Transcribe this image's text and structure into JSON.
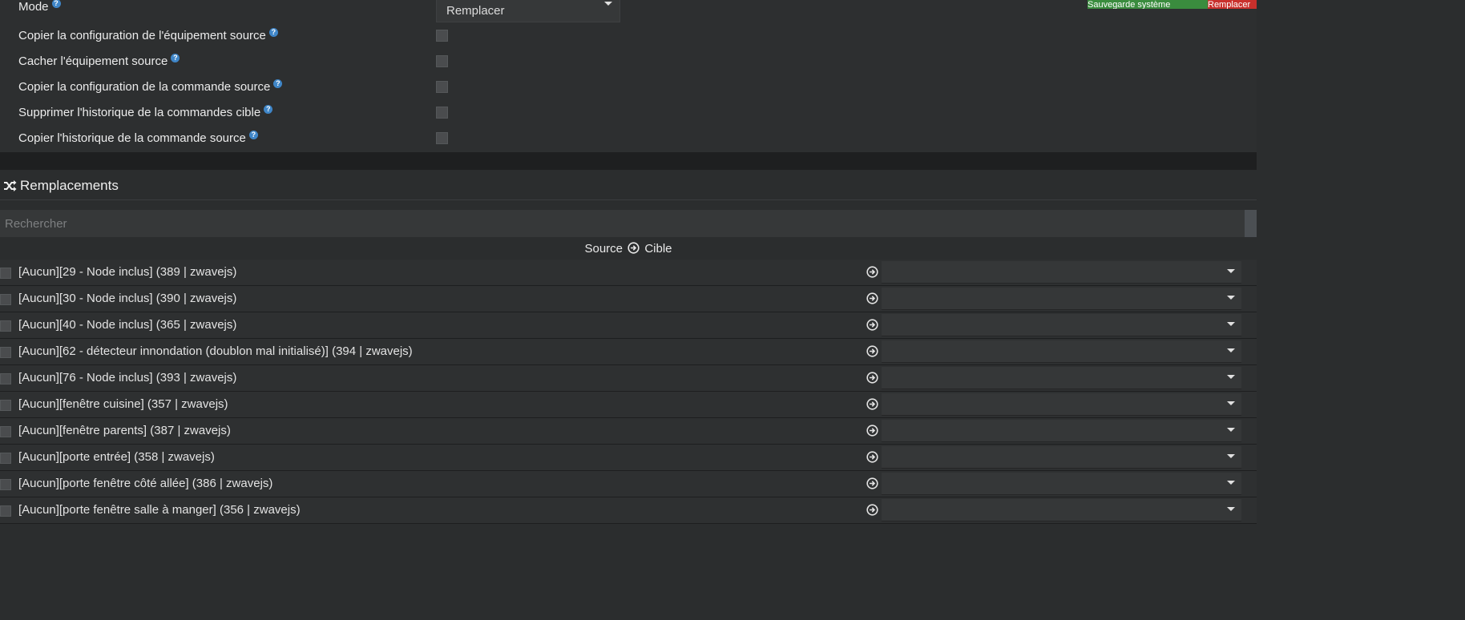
{
  "top_buttons": {
    "backup_label": "Sauvegarde système",
    "other_label": "Remplacer"
  },
  "mode": {
    "label": "Mode",
    "value": "Remplacer"
  },
  "options": [
    "Copier la configuration de l'équipement source",
    "Cacher l'équipement source",
    "Copier la configuration de la commande source",
    "Supprimer l'historique de la commandes cible",
    "Copier l'historique de la commande source"
  ],
  "help_glyph": "?",
  "replacements": {
    "title": "Remplacements",
    "icon": "shuffle-icon",
    "search_placeholder": "Rechercher",
    "header_source": "Source",
    "header_target": "Cible",
    "rows": [
      "[Aucun][29 - Node inclus] (389 | zwavejs)",
      "[Aucun][30 - Node inclus] (390 | zwavejs)",
      "[Aucun][40 - Node inclus] (365 | zwavejs)",
      "[Aucun][62 - détecteur innondation (doublon mal initialisé)] (394 | zwavejs)",
      "[Aucun][76 - Node inclus] (393 | zwavejs)",
      "[Aucun][fenêtre cuisine] (357 | zwavejs)",
      "[Aucun][fenêtre parents] (387 | zwavejs)",
      "[Aucun][porte entrée] (358 | zwavejs)",
      "[Aucun][porte fenêtre côté allée] (386 | zwavejs)",
      "[Aucun][porte fenêtre salle à manger] (356 | zwavejs)"
    ]
  },
  "colors": {
    "accent_help": "#3f86c8",
    "backup_green": "#3a8c3e",
    "danger_red": "#c9302c"
  }
}
